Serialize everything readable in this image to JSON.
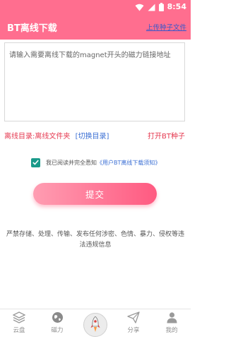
{
  "status_bar": {
    "time": "8:54",
    "icons": [
      "wifi-icon",
      "signal-icon",
      "battery-icon"
    ]
  },
  "app_bar": {
    "title": "BT离线下载",
    "action_label": "上传种子文件"
  },
  "link_input": {
    "value": "",
    "placeholder": "请输入需要离线下载的magnet开头的磁力链接地址"
  },
  "directory": {
    "label": "离线目录:离线文件夹",
    "switch_label": "[切换目录]",
    "open_bt_label": "打开BT种子"
  },
  "agreement": {
    "checked": true,
    "text": "我已阅读并完全悉知",
    "link": "《用户BT离线下载须知》"
  },
  "submit": {
    "label": "提交"
  },
  "notice": {
    "text": "严禁存储、处理、传输、发布任何涉密、色情、暴力、侵权等违法违规信息"
  },
  "bottom_nav": {
    "items": [
      {
        "label": "云盘",
        "icon": "layers-icon"
      },
      {
        "label": "磁力",
        "icon": "globe-icon"
      },
      {
        "label": "",
        "icon": "rocket-icon"
      },
      {
        "label": "分享",
        "icon": "paper-plane-icon"
      },
      {
        "label": "我的",
        "icon": "user-icon"
      }
    ]
  },
  "colors": {
    "primary": "#ff6e8f",
    "accent_red": "#e53950",
    "link_blue": "#3b6fd4",
    "checkbox_teal": "#1a9a8a"
  }
}
